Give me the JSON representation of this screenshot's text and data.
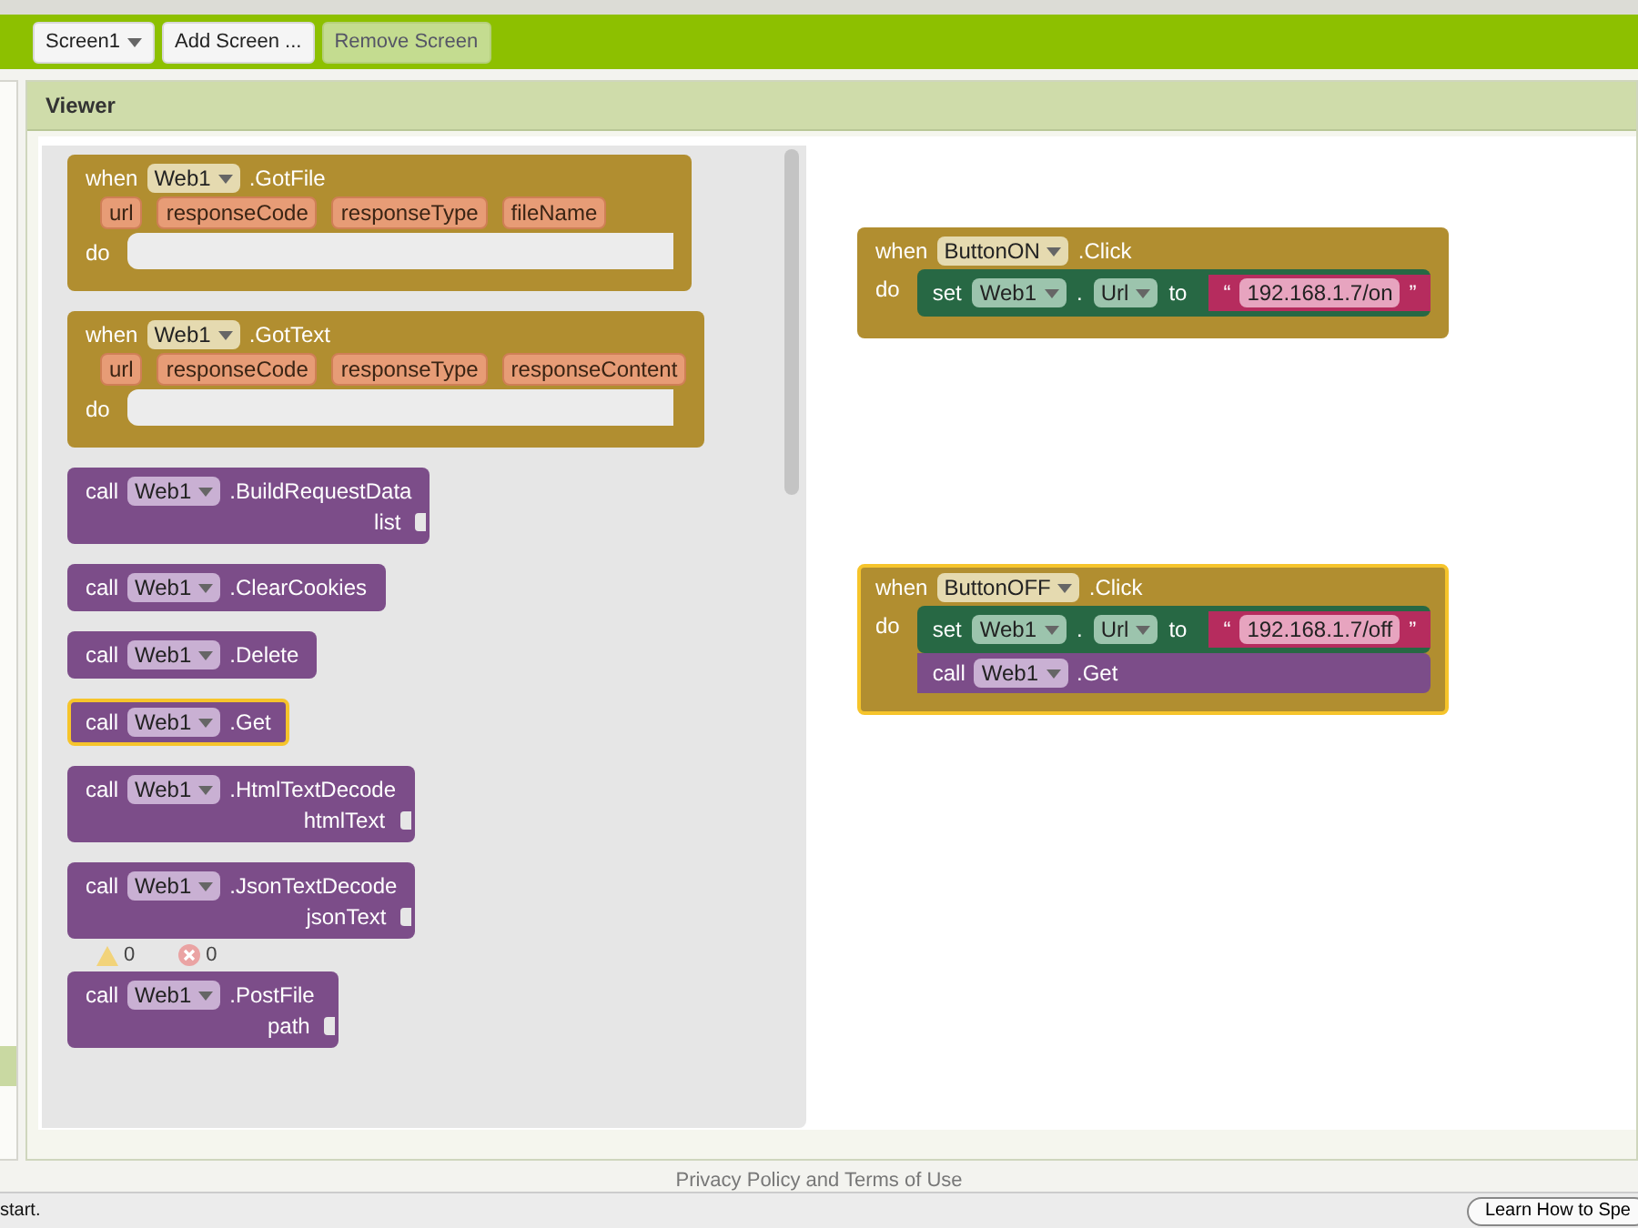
{
  "toolbar": {
    "buttons": [
      {
        "label": "Screen1",
        "kind": "dropdown",
        "disabled": false
      },
      {
        "label": "Add Screen ...",
        "kind": "plain",
        "disabled": false
      },
      {
        "label": "Remove Screen",
        "kind": "plain",
        "disabled": true
      }
    ]
  },
  "viewer": {
    "title": "Viewer"
  },
  "flyout": {
    "blocks": [
      {
        "kind": "event",
        "keyword": "when",
        "component": "Web1",
        "name": ".GotFile",
        "params": [
          "url",
          "responseCode",
          "responseType",
          "fileName"
        ],
        "do_label": "do",
        "selected": false
      },
      {
        "kind": "event",
        "keyword": "when",
        "component": "Web1",
        "name": ".GotText",
        "params": [
          "url",
          "responseCode",
          "responseType",
          "responseContent"
        ],
        "do_label": "do",
        "selected": false
      },
      {
        "kind": "call",
        "keyword": "call",
        "component": "Web1",
        "name": ".BuildRequestData",
        "args": [
          "list"
        ],
        "selected": false
      },
      {
        "kind": "call",
        "keyword": "call",
        "component": "Web1",
        "name": ".ClearCookies",
        "selected": false
      },
      {
        "kind": "call",
        "keyword": "call",
        "component": "Web1",
        "name": ".Delete",
        "selected": false
      },
      {
        "kind": "call",
        "keyword": "call",
        "component": "Web1",
        "name": ".Get",
        "selected": true
      },
      {
        "kind": "call",
        "keyword": "call",
        "component": "Web1",
        "name": ".HtmlTextDecode",
        "args": [
          "htmlText"
        ],
        "selected": false
      },
      {
        "kind": "call",
        "keyword": "call",
        "component": "Web1",
        "name": ".JsonTextDecode",
        "args": [
          "jsonText"
        ],
        "selected": false
      },
      {
        "kind": "call",
        "keyword": "call",
        "component": "Web1",
        "name": ".PostFile",
        "args": [
          "path"
        ],
        "selected": false
      }
    ]
  },
  "workspace": {
    "blocks": [
      {
        "kind": "event",
        "keyword": "when",
        "component": "ButtonON",
        "name": ".Click",
        "do_label": "do",
        "selected": false,
        "statements": [
          {
            "kind": "set",
            "keyword": "set",
            "component": "Web1",
            "dot": ".",
            "property": "Url",
            "to": "to",
            "quote_open": "“",
            "value": "192.168.1.7/on",
            "quote_close": "”"
          }
        ]
      },
      {
        "kind": "event",
        "keyword": "when",
        "component": "ButtonOFF",
        "name": ".Click",
        "do_label": "do",
        "selected": true,
        "statements": [
          {
            "kind": "set",
            "keyword": "set",
            "component": "Web1",
            "dot": ".",
            "property": "Url",
            "to": "to",
            "quote_open": "“",
            "value": "192.168.1.7/off",
            "quote_close": "”"
          },
          {
            "kind": "call",
            "keyword": "call",
            "component": "Web1",
            "name": ".Get"
          }
        ]
      }
    ],
    "warnings": {
      "count": "0"
    },
    "errors": {
      "count": "0"
    }
  },
  "footer": {
    "link": "Privacy Policy and Terms of Use"
  },
  "status_bar": {
    "message": "start.",
    "button": "Learn How to Spe"
  }
}
